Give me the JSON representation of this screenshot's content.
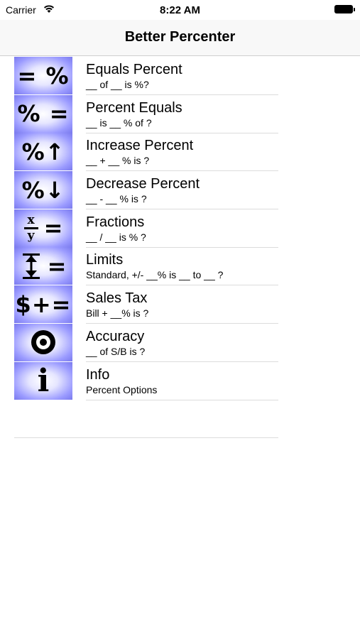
{
  "status_bar": {
    "carrier": "Carrier",
    "time": "8:22 AM"
  },
  "nav": {
    "title": "Better Percenter"
  },
  "items": [
    {
      "icon": "equals-percent-icon",
      "symbol": "= %",
      "title": "Equals Percent",
      "subtitle": "__ of __ is %?"
    },
    {
      "icon": "percent-equals-icon",
      "symbol": "% =",
      "title": "Percent Equals",
      "subtitle": "__ is __ % of ?"
    },
    {
      "icon": "percent-increase-icon",
      "symbol": "%↑",
      "title": "Increase Percent",
      "subtitle": "__ + __ % is ?"
    },
    {
      "icon": "percent-decrease-icon",
      "symbol": "%↓",
      "title": "Decrease Percent",
      "subtitle": "__ - __ % is ?"
    },
    {
      "icon": "fraction-icon",
      "symbol": "x/y =",
      "title": "Fractions",
      "subtitle": "__ / __ is % ?"
    },
    {
      "icon": "limits-icon",
      "symbol": "↕ =",
      "title": "Limits",
      "subtitle": "Standard,  +/- __% is __ to __ ?"
    },
    {
      "icon": "sales-tax-icon",
      "symbol": "$+=",
      "title": "Sales Tax",
      "subtitle": "Bill + __% is ?"
    },
    {
      "icon": "bullseye-icon",
      "symbol": "◉",
      "title": "Accuracy",
      "subtitle": "__ of S/B is ?"
    },
    {
      "icon": "info-icon",
      "symbol": "i",
      "title": "Info",
      "subtitle": "Percent Options"
    }
  ]
}
